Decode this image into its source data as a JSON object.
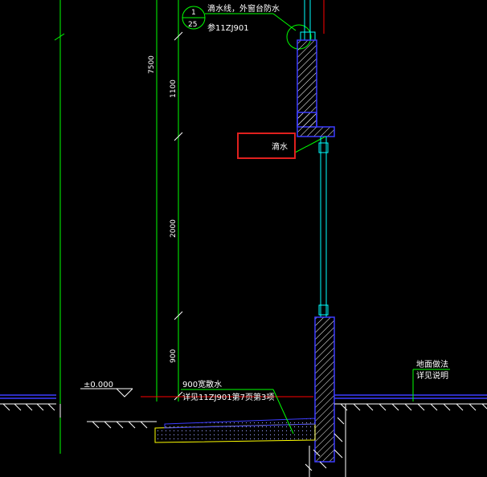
{
  "dimensions": {
    "total": "7500",
    "segment_top": "1100",
    "segment_mid": "2000",
    "segment_bottom": "900"
  },
  "detail_callout": {
    "number": "1",
    "sheet": "25",
    "note": "滴水线，外窗台防水",
    "ref": "参11ZJ901"
  },
  "highlight_label": "滴水",
  "elevation_mark": "±0.000",
  "plinth_note": {
    "line1": "900宽散水",
    "line2": "详见11ZJ901第7页第3项"
  },
  "floor_note": {
    "line1": "地面做法",
    "line2": "详见说明"
  },
  "colors": {
    "background": "#000000",
    "line_white": "#ffffff",
    "line_green": "#00ff00",
    "line_cyan": "#00ffff",
    "line_blue": "#3c3cff",
    "line_red": "#ff0000",
    "highlight": "#e0201e",
    "fill_yellow": "#ffff00"
  }
}
